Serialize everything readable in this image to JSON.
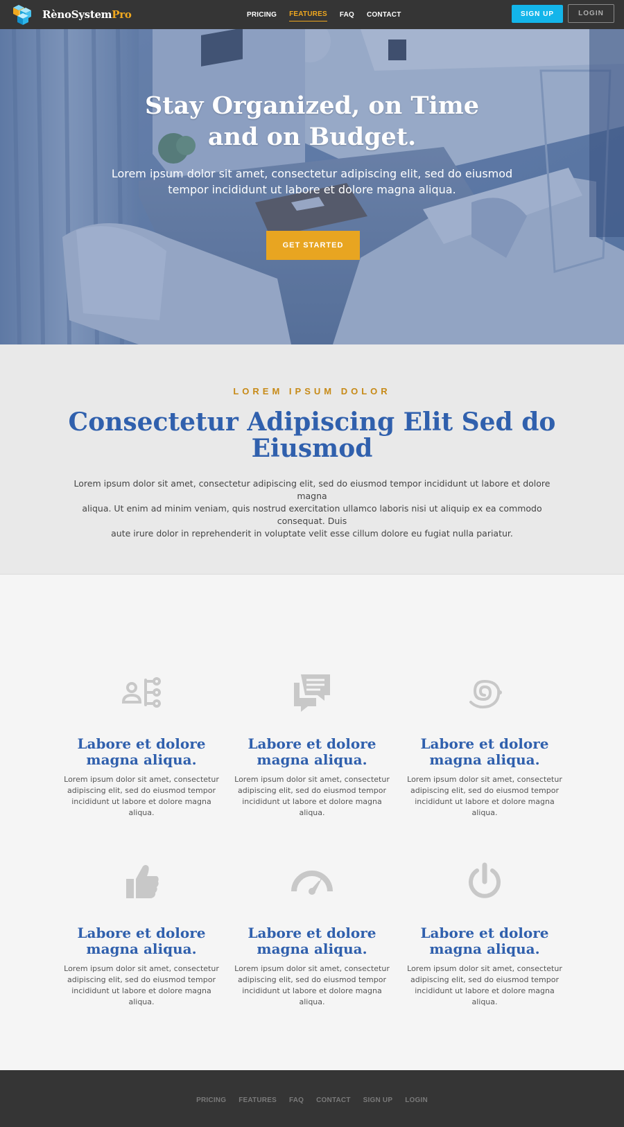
{
  "brand": {
    "name_main": "RènoSystem",
    "name_accent": "Pro"
  },
  "nav": {
    "items": [
      {
        "label": "PRICING",
        "active": false
      },
      {
        "label": "FEATURES",
        "active": true
      },
      {
        "label": "FAQ",
        "active": false
      },
      {
        "label": "CONTACT",
        "active": false
      }
    ],
    "signup_label": "SIGN UP",
    "login_label": "LOGIN"
  },
  "hero": {
    "title_line1": "Stay Organized, on Time",
    "title_line2": "and on Budget.",
    "subtitle_line1": "Lorem ipsum dolor sit amet, consectetur adipiscing elit, sed do eiusmod",
    "subtitle_line2": "tempor incididunt ut labore et dolore magna aliqua.",
    "cta_label": "GET STARTED"
  },
  "intro": {
    "eyebrow": "LOREM IPSUM DOLOR",
    "title_line1": "Consectetur Adipiscing Elit Sed do",
    "title_line2": "Eiusmod",
    "text_line1": "Lorem ipsum dolor sit amet, consectetur adipiscing elit, sed do eiusmod tempor incididunt ut labore et dolore magna",
    "text_line2": "aliqua. Ut enim ad minim veniam, quis nostrud exercitation ullamco laboris nisi ut aliquip ex ea commodo consequat. Duis",
    "text_line3": "aute irure dolor in reprehenderit in voluptate velit esse cillum dolore eu fugiat nulla pariatur."
  },
  "features": [
    {
      "icon": "org-chart-icon",
      "title_line1": "Labore et dolore",
      "title_line2": "magna aliqua.",
      "text_line1": "Lorem ipsum dolor sit amet, consectetur",
      "text_line2": "adipiscing elit, sed do eiusmod tempor",
      "text_line3": "incididunt ut labore et dolore magna aliqua."
    },
    {
      "icon": "chat-icon",
      "title_line1": "Labore et dolore",
      "title_line2": "magna aliqua.",
      "text_line1": "Lorem ipsum dolor sit amet, consectetur",
      "text_line2": "adipiscing elit, sed do eiusmod tempor",
      "text_line3": "incididunt ut labore et dolore magna aliqua."
    },
    {
      "icon": "spiral-icon",
      "title_line1": "Labore et dolore",
      "title_line2": "magna aliqua.",
      "text_line1": "Lorem ipsum dolor sit amet, consectetur",
      "text_line2": "adipiscing elit, sed do eiusmod tempor",
      "text_line3": "incididunt ut labore et dolore magna aliqua."
    },
    {
      "icon": "thumbs-up-icon",
      "title_line1": "Labore et dolore",
      "title_line2": "magna aliqua.",
      "text_line1": "Lorem ipsum dolor sit amet, consectetur",
      "text_line2": "adipiscing elit, sed do eiusmod tempor",
      "text_line3": "incididunt ut labore et dolore magna aliqua."
    },
    {
      "icon": "speedometer-icon",
      "title_line1": "Labore et dolore",
      "title_line2": "magna aliqua.",
      "text_line1": "Lorem ipsum dolor sit amet, consectetur",
      "text_line2": "adipiscing elit, sed do eiusmod tempor",
      "text_line3": "incididunt ut labore et dolore magna aliqua."
    },
    {
      "icon": "power-icon",
      "title_line1": "Labore et dolore",
      "title_line2": "magna aliqua.",
      "text_line1": "Lorem ipsum dolor sit amet, consectetur",
      "text_line2": "adipiscing elit, sed do eiusmod tempor",
      "text_line3": "incididunt ut labore et dolore magna aliqua."
    }
  ],
  "footer": {
    "items": [
      "PRICING",
      "FEATURES",
      "FAQ",
      "CONTACT",
      "SIGN UP",
      "LOGIN"
    ]
  },
  "colors": {
    "nav_bg": "#353535",
    "accent_orange": "#e8a521",
    "brand_blue": "#3060ad",
    "signup_cyan": "#13b5ea",
    "icon_gray": "#c8c8c8"
  }
}
